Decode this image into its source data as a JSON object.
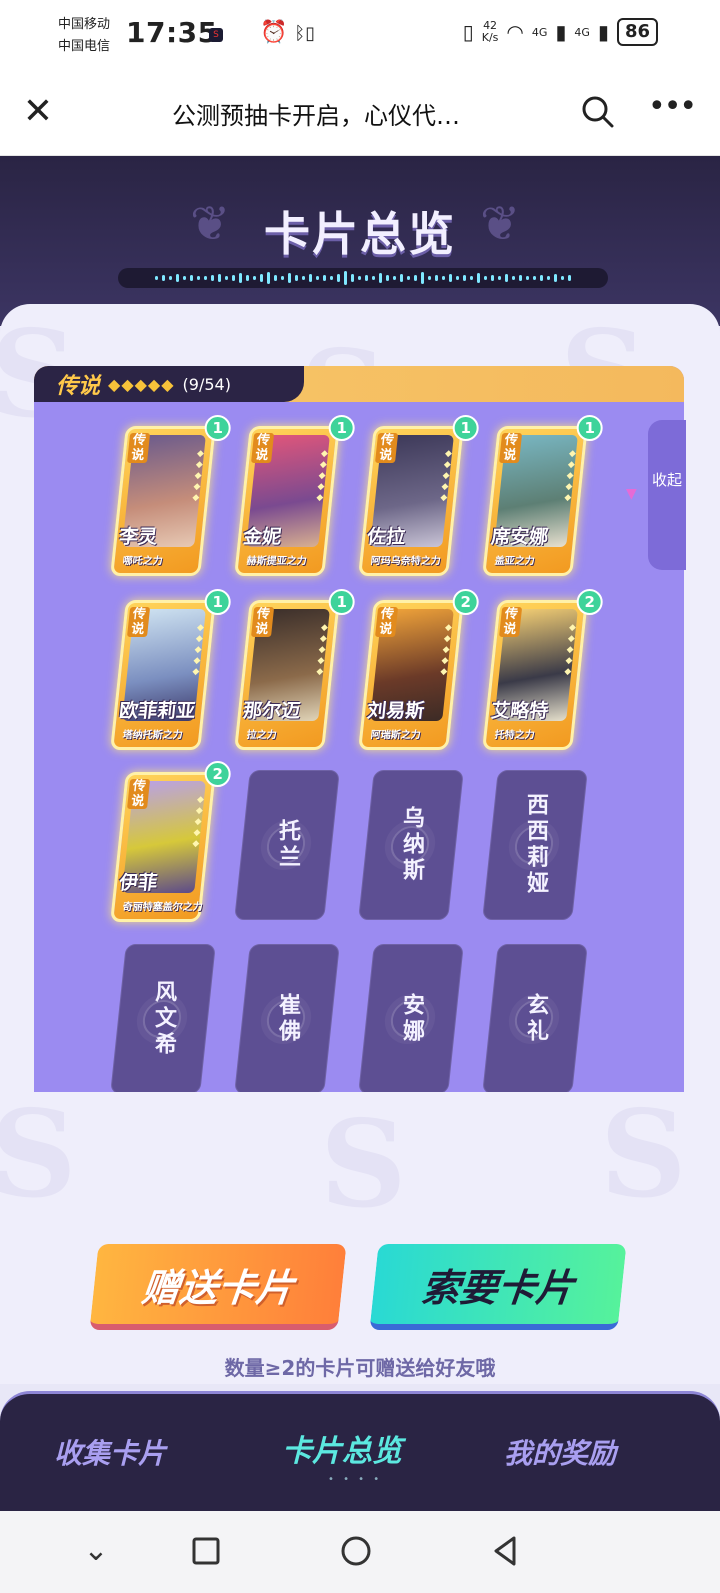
{
  "status": {
    "carrier1": "中国移动",
    "carrier2": "中国电信",
    "time": "17:35",
    "net_speed_value": "42",
    "net_speed_unit": "K/s",
    "signal1": "4G",
    "signal2": "4G",
    "battery": "86"
  },
  "titlebar": {
    "title": "公测预抽卡开启，心仪代…"
  },
  "header": {
    "title": "卡片总览"
  },
  "legend": {
    "label": "传说",
    "stars": "◆◆◆◆◆",
    "count": "(9/54)",
    "collapse_label": "收起"
  },
  "owned_cards": [
    {
      "tag": "传说",
      "name": "李灵",
      "power": "哪吒之力",
      "count": "1"
    },
    {
      "tag": "传说",
      "name": "金妮",
      "power": "赫斯提亚之力",
      "count": "1"
    },
    {
      "tag": "传说",
      "name": "佐拉",
      "power": "阿玛乌奈特之力",
      "count": "1"
    },
    {
      "tag": "传说",
      "name": "席安娜",
      "power": "盖亚之力",
      "count": "1"
    },
    {
      "tag": "传说",
      "name": "欧菲莉亚",
      "power": "塔纳托斯之力",
      "count": "1"
    },
    {
      "tag": "传说",
      "name": "那尔迈",
      "power": "拉之力",
      "count": "1"
    },
    {
      "tag": "传说",
      "name": "刘易斯",
      "power": "阿瑞斯之力",
      "count": "2"
    },
    {
      "tag": "传说",
      "name": "艾略特",
      "power": "托特之力",
      "count": "2"
    },
    {
      "tag": "传说",
      "name": "伊菲",
      "power": "奇丽特塞盖尔之力",
      "count": "2"
    }
  ],
  "locked_cards": [
    "托兰",
    "乌纳斯",
    "西西莉娅",
    "风文希",
    "崔佛",
    "安娜",
    "玄礼"
  ],
  "buttons": {
    "gift": "赠送卡片",
    "ask": "索要卡片"
  },
  "hint": "数量≥2的卡片可赠送给好友哦",
  "bottom_nav": {
    "collect": "收集卡片",
    "overview": "卡片总览",
    "rewards": "我的奖励",
    "active": "卡片总览"
  },
  "colors": {
    "legend_bg": "#9b8bf1",
    "card_gold": "#f4b23a",
    "badge": "#3ed39a",
    "locked_card": "#5d4f93",
    "nav_active": "#5ce8e0"
  }
}
